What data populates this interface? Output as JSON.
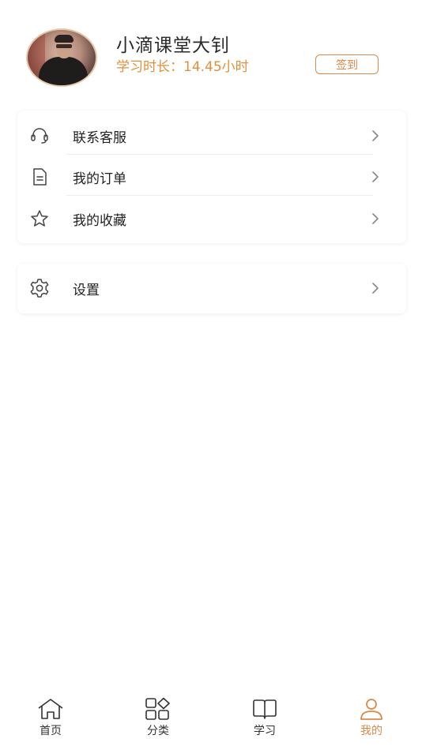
{
  "profile": {
    "username": "小滴课堂大钊",
    "study_time": "学习时长：14.45小时",
    "checkin_label": "签到"
  },
  "menu_group_1": {
    "items": [
      {
        "label": "联系客服",
        "icon": "headset-icon"
      },
      {
        "label": "我的订单",
        "icon": "document-icon"
      },
      {
        "label": "我的收藏",
        "icon": "star-icon"
      }
    ]
  },
  "menu_group_2": {
    "items": [
      {
        "label": "设置",
        "icon": "gear-icon"
      }
    ]
  },
  "tabbar": {
    "tabs": [
      {
        "label": "首页",
        "icon": "home-icon",
        "active": false
      },
      {
        "label": "分类",
        "icon": "category-icon",
        "active": false
      },
      {
        "label": "学习",
        "icon": "book-icon",
        "active": false
      },
      {
        "label": "我的",
        "icon": "person-icon",
        "active": true
      }
    ]
  },
  "colors": {
    "accent": "#d9894a",
    "study_time": "#e0903a",
    "text": "#222222",
    "icon": "#444444"
  }
}
